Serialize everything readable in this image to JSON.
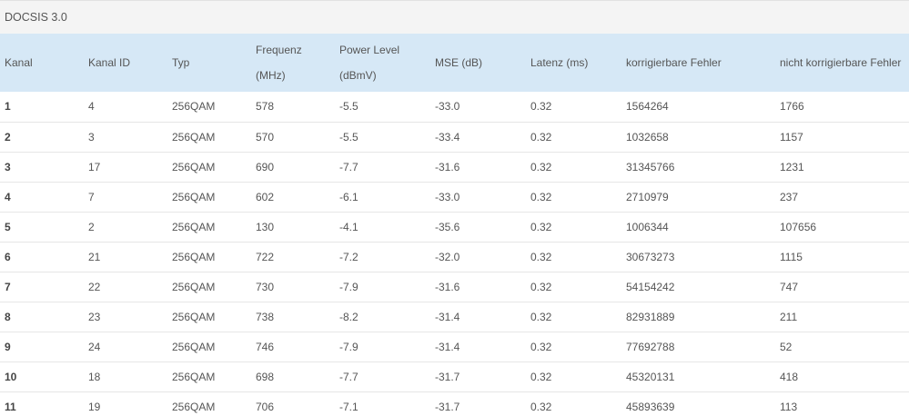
{
  "section_title": "DOCSIS 3.0",
  "columns": [
    {
      "line1": "Kanal",
      "line2": ""
    },
    {
      "line1": "Kanal ID",
      "line2": ""
    },
    {
      "line1": "Typ",
      "line2": ""
    },
    {
      "line1": "Frequenz",
      "line2": "(MHz)"
    },
    {
      "line1": "Power Level",
      "line2": "(dBmV)"
    },
    {
      "line1": "MSE (dB)",
      "line2": ""
    },
    {
      "line1": "Latenz (ms)",
      "line2": ""
    },
    {
      "line1": "korrigierbare Fehler",
      "line2": ""
    },
    {
      "line1": "nicht korrigierbare Fehler",
      "line2": ""
    }
  ],
  "rows": [
    [
      "1",
      "4",
      "256QAM",
      "578",
      "-5.5",
      "-33.0",
      "0.32",
      "1564264",
      "1766"
    ],
    [
      "2",
      "3",
      "256QAM",
      "570",
      "-5.5",
      "-33.4",
      "0.32",
      "1032658",
      "1157"
    ],
    [
      "3",
      "17",
      "256QAM",
      "690",
      "-7.7",
      "-31.6",
      "0.32",
      "31345766",
      "1231"
    ],
    [
      "4",
      "7",
      "256QAM",
      "602",
      "-6.1",
      "-33.0",
      "0.32",
      "2710979",
      "237"
    ],
    [
      "5",
      "2",
      "256QAM",
      "130",
      "-4.1",
      "-35.6",
      "0.32",
      "1006344",
      "107656"
    ],
    [
      "6",
      "21",
      "256QAM",
      "722",
      "-7.2",
      "-32.0",
      "0.32",
      "30673273",
      "1115"
    ],
    [
      "7",
      "22",
      "256QAM",
      "730",
      "-7.9",
      "-31.6",
      "0.32",
      "54154242",
      "747"
    ],
    [
      "8",
      "23",
      "256QAM",
      "738",
      "-8.2",
      "-31.4",
      "0.32",
      "82931889",
      "211"
    ],
    [
      "9",
      "24",
      "256QAM",
      "746",
      "-7.9",
      "-31.4",
      "0.32",
      "77692788",
      "52"
    ],
    [
      "10",
      "18",
      "256QAM",
      "698",
      "-7.7",
      "-31.7",
      "0.32",
      "45320131",
      "418"
    ],
    [
      "11",
      "19",
      "256QAM",
      "706",
      "-7.1",
      "-31.7",
      "0.32",
      "45893639",
      "113"
    ]
  ]
}
